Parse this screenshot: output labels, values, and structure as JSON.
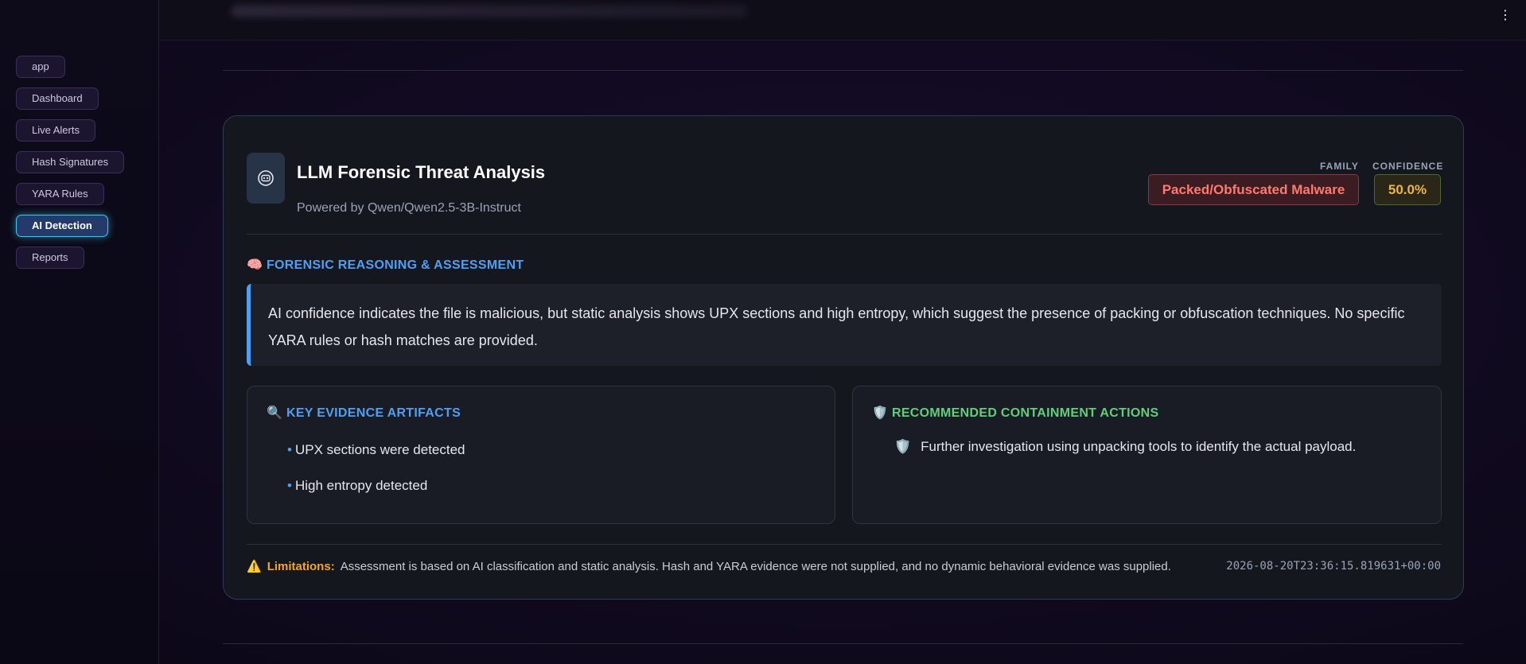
{
  "sidebar": {
    "items": [
      {
        "label": "app"
      },
      {
        "label": "Dashboard"
      },
      {
        "label": "Live Alerts"
      },
      {
        "label": "Hash Signatures"
      },
      {
        "label": "YARA Rules"
      },
      {
        "label": "AI Detection"
      },
      {
        "label": "Reports"
      }
    ],
    "active": "AI Detection"
  },
  "header": {
    "title": "LLM Forensic Threat Analysis",
    "subtitle": "Powered by Qwen/Qwen2.5-3B-Instruct",
    "family_label": "FAMILY",
    "family_value": "Packed/Obfuscated Malware",
    "confidence_label": "CONFIDENCE",
    "confidence_value": "50.0%"
  },
  "reasoning": {
    "heading_icon": "🧠",
    "heading": "FORENSIC REASONING & ASSESSMENT",
    "text": "AI confidence indicates the file is malicious, but static analysis shows UPX sections and high entropy, which suggest the presence of packing or obfuscation techniques. No specific YARA rules or hash matches are provided."
  },
  "evidence": {
    "heading_icon": "🔍",
    "heading": "KEY EVIDENCE ARTIFACTS",
    "bullet": "•",
    "items": [
      "UPX sections were detected",
      "High entropy detected"
    ]
  },
  "containment": {
    "heading_icon": "🛡️",
    "heading": "RECOMMENDED CONTAINMENT ACTIONS",
    "items": [
      {
        "icon": "🛡️",
        "text": "Further investigation using unpacking tools to identify the actual payload."
      }
    ]
  },
  "footer": {
    "warning_icon": "⚠️",
    "limitations_label": "Limitations:",
    "limitations_text": "Assessment is based on AI classification and static analysis. Hash and YARA evidence were not supplied, and no dynamic behavioral evidence was supplied.",
    "timestamp": "2026-08-20T23:36:15.819631+00:00"
  },
  "colors": {
    "accent_blue": "#4f9ff5",
    "accent_green": "#5fd07a",
    "family_red": "#ff7a6e",
    "confidence_amber": "#f0b542",
    "active_nav_cyan": "#36c9ee"
  },
  "icons": {
    "topbar_menu": "kebab-menu-icon",
    "card_icon": "ai-brain-chip-icon"
  }
}
